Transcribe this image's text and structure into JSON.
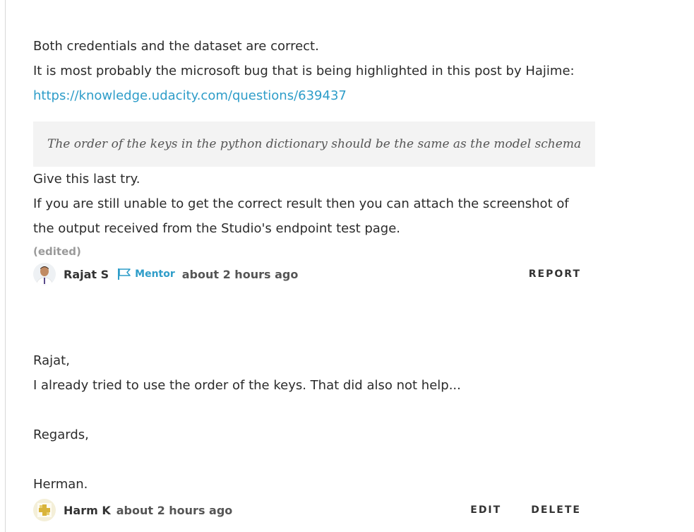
{
  "reply1": {
    "lines": [
      "Both credentials and the dataset are correct.",
      "It is most probably the microsoft bug that is being highlighted in this post by Hajime:"
    ],
    "link": "https://knowledge.udacity.com/questions/639437",
    "quote": "The order of the keys in the python dictionary should be the same as the model schema",
    "after_lines": [
      "Give this last try.",
      "If you are still unable to get the correct result then you can attach the screenshot of",
      "the output received from the Studio's endpoint test page."
    ],
    "edited_label": "(edited)",
    "author": "Rajat S",
    "role": "Mentor",
    "time": "about 2 hours ago",
    "report_label": "REPORT"
  },
  "reply2": {
    "greeting": "Rajat,",
    "body": "I already tried to use the order of the keys. That did also not help...",
    "closing": "Regards,",
    "signature": "Herman.",
    "author": "Harm K",
    "time": "about 2 hours ago",
    "edit_label": "EDIT",
    "delete_label": "DELETE"
  },
  "colors": {
    "link": "#2e9dc9",
    "quote_bg": "#f3f3f3"
  }
}
